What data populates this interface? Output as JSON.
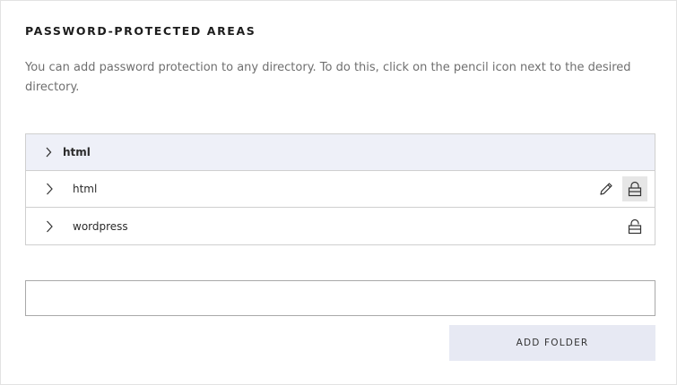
{
  "section": {
    "title": "PASSWORD-PROTECTED AREAS",
    "description": "You can add password protection to any directory. To do this, click on the pencil icon next to the desired directory."
  },
  "tree": {
    "root": {
      "label": "html",
      "icon": "chevron-right-icon"
    },
    "items": [
      {
        "label": "html",
        "icons": [
          "pencil-icon",
          "lock-icon"
        ],
        "lock_state": "locked-highlighted"
      },
      {
        "label": "wordpress",
        "icons": [
          "unlock-icon"
        ],
        "lock_state": "unlocked"
      }
    ]
  },
  "new_folder": {
    "value": "",
    "placeholder": "",
    "button_label": "ADD FOLDER"
  },
  "colors": {
    "root_row_bg": "#eef0f8",
    "button_bg": "#e7e9f3",
    "border": "#cfcfcf"
  }
}
